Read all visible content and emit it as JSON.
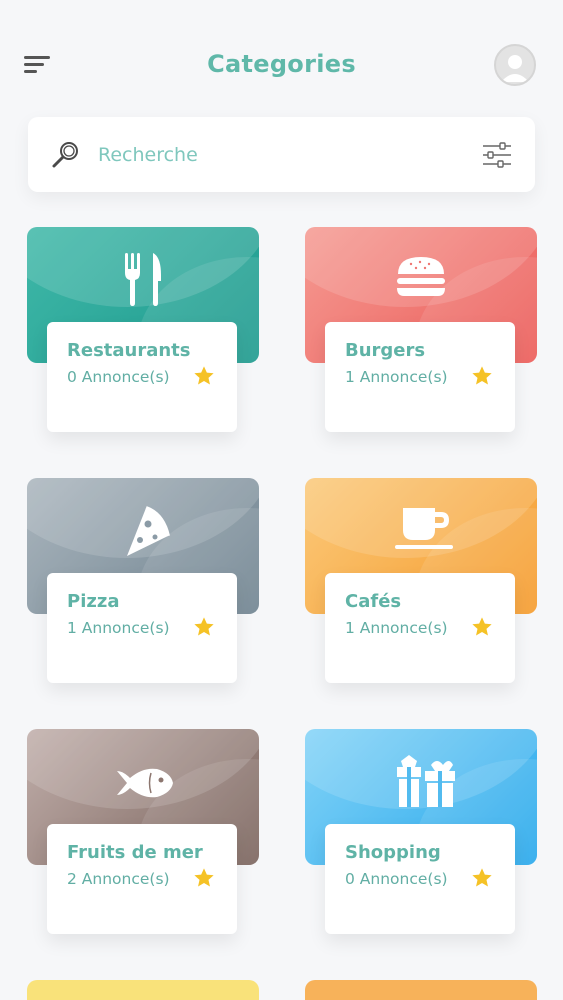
{
  "header": {
    "title": "Categories",
    "title_color": "#5fb8a9",
    "menu_icon": "hamburger-menu-icon",
    "avatar_icon": "user-avatar-icon"
  },
  "search": {
    "placeholder": "Recherche",
    "search_icon": "magnifier-icon",
    "filter_icon": "filter-sliders-icon"
  },
  "categories": [
    {
      "name": "Restaurants",
      "count": "0 Annonce(s)",
      "icon": "fork-knife-icon",
      "color_from": "#3fb8a8",
      "color_to": "#1e9a8e"
    },
    {
      "name": "Burgers",
      "count": "1 Annonce(s)",
      "icon": "burger-icon",
      "color_from": "#f59a92",
      "color_to": "#ec5b58"
    },
    {
      "name": "Pizza",
      "count": "1 Annonce(s)",
      "icon": "pizza-slice-icon",
      "color_from": "#aab5bd",
      "color_to": "#6f8390"
    },
    {
      "name": "Cafés",
      "count": "1 Annonce(s)",
      "icon": "coffee-cup-icon",
      "color_from": "#fbc97a",
      "color_to": "#f59b2c"
    },
    {
      "name": "Fruits de mer",
      "count": "2 Annonce(s)",
      "icon": "fish-icon",
      "color_from": "#c0aeaa",
      "color_to": "#7a635c"
    },
    {
      "name": "Shopping",
      "count": "0 Annonce(s)",
      "icon": "gift-icon",
      "color_from": "#83d3f7",
      "color_to": "#27a8ec"
    }
  ],
  "star_icon": "star-icon",
  "star_color": "#f5c226",
  "peek_colors": [
    "#f9e27a",
    "#f7b25a"
  ]
}
